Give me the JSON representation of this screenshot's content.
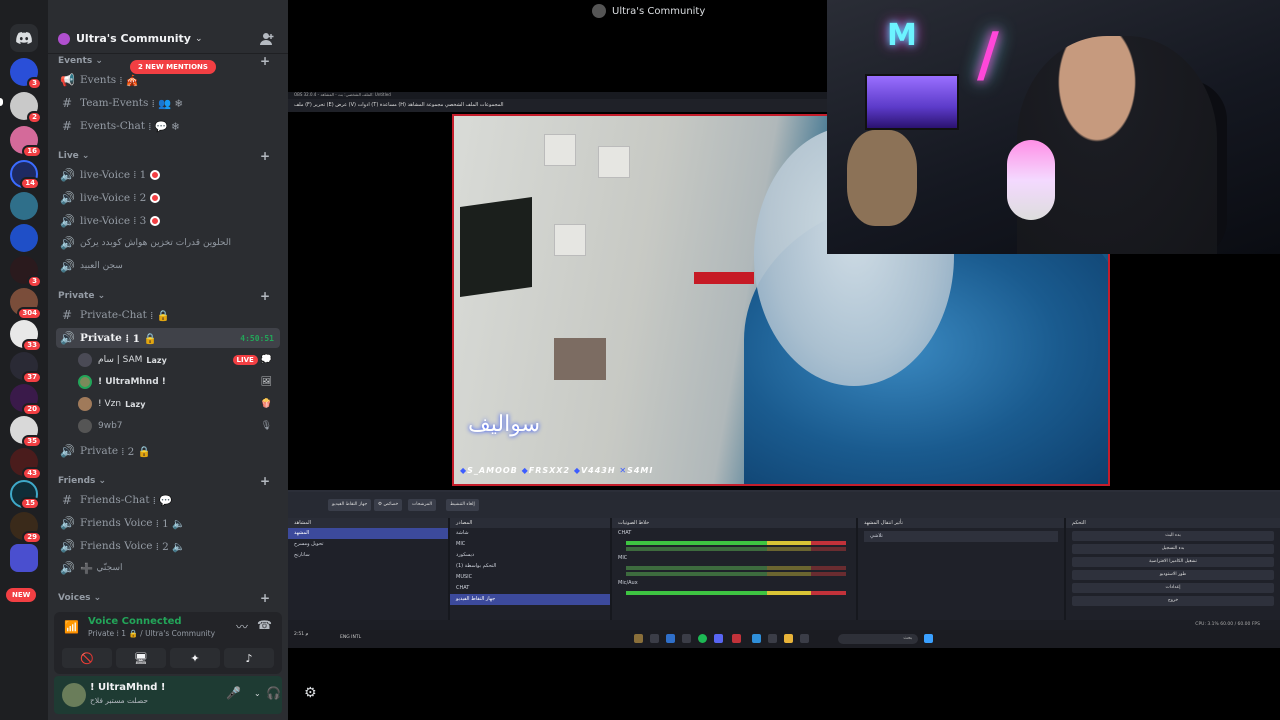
{
  "stream": {
    "title": "Ultra's Community"
  },
  "server": {
    "name": "Ultra's Community",
    "mentions": "2 NEW MENTIONS"
  },
  "rail": {
    "badges": [
      "3",
      "2",
      "16",
      "14",
      "3",
      "304",
      "33",
      "37",
      "20",
      "35",
      "43",
      "15",
      "29"
    ],
    "new_label": "NEW"
  },
  "categories": {
    "events": "Events",
    "live": "Live",
    "private": "Private",
    "friends": "Friends",
    "voices": "Voices"
  },
  "channels": {
    "events": "Events",
    "team_events": "Team-Events",
    "events_chat": "Events-Chat",
    "live_voice_1": "live-Voice",
    "live_voice_2": "live-Voice",
    "live_voice_3": "live-Voice",
    "ar_channel_1": "الحلوين قدرات تخزين هواش كوبدد يركن",
    "ar_channel_2": "سجن العبيد",
    "private_chat": "Private-Chat",
    "private_1": "Private",
    "private_1_timer": "4:50:51",
    "private_2": "Private",
    "friends_chat": "Friends-Chat",
    "friends_voice_1": "Friends Voice",
    "friends_voice_2": "Friends Voice",
    "ar_channel_3": "اسجنّي"
  },
  "voice_users": [
    {
      "name": "سام | SAM",
      "tag": "Lazy",
      "live": "LIVE"
    },
    {
      "name": "! UltraMhnd !"
    },
    {
      "name": "! Vzn",
      "tag": "Lazy"
    },
    {
      "name": "9wb7"
    }
  ],
  "voice_panel": {
    "status": "Voice Connected",
    "location": "Private ⁞ 1 🔒 / Ultra's Community"
  },
  "user": {
    "name": "! UltraMhnd !",
    "status": "حصلت مستبر فلاح"
  },
  "obs": {
    "window_title": "OBS 32.0.4 - الملف الشخصي: بث - المشاهد: Untitled",
    "menu": "ملف (F)  تحرير (E)  عرض (V)  ادوات (T)  مساعدة (H)  المجموعات  الملف الشخصي  مجموعة المشاهد",
    "watermark": "سواليف",
    "credits": [
      "S_AMOOB",
      "FRSXX2",
      "V443H",
      "S4MI"
    ],
    "scenes_header": "المشاهد",
    "scenes": [
      "المشهد",
      "تحويل ومسرح",
      "ساتارنج"
    ],
    "sources_header": "المصادر",
    "sources": [
      "شاشة",
      "MIC",
      "ديسكورد",
      "التحكم بواسطة (1)",
      "MUSIC",
      "CHAT",
      "جهاز التقاط الفيديو"
    ],
    "mixer_header": "خلاط الصوتيات",
    "mixer": [
      "CHAT",
      "MIC",
      "Mic/Aux"
    ],
    "transitions_header": "تأثير انتقال المشهد",
    "transition_value": "تلاشي",
    "controls_header": "التحكم",
    "controls": [
      "بدء البث",
      "بدء التسجيل",
      "تشغيل الكاميرا الافتراضية",
      "طور الاستوديو",
      "إعدادات",
      "خروج"
    ],
    "status_bar": "CPU: 3.1%   60.00 / 60.00 FPS",
    "taskbar_search": "بحث",
    "taskbar_time": "2:51 م",
    "taskbar_lang": "ENG INTL"
  }
}
